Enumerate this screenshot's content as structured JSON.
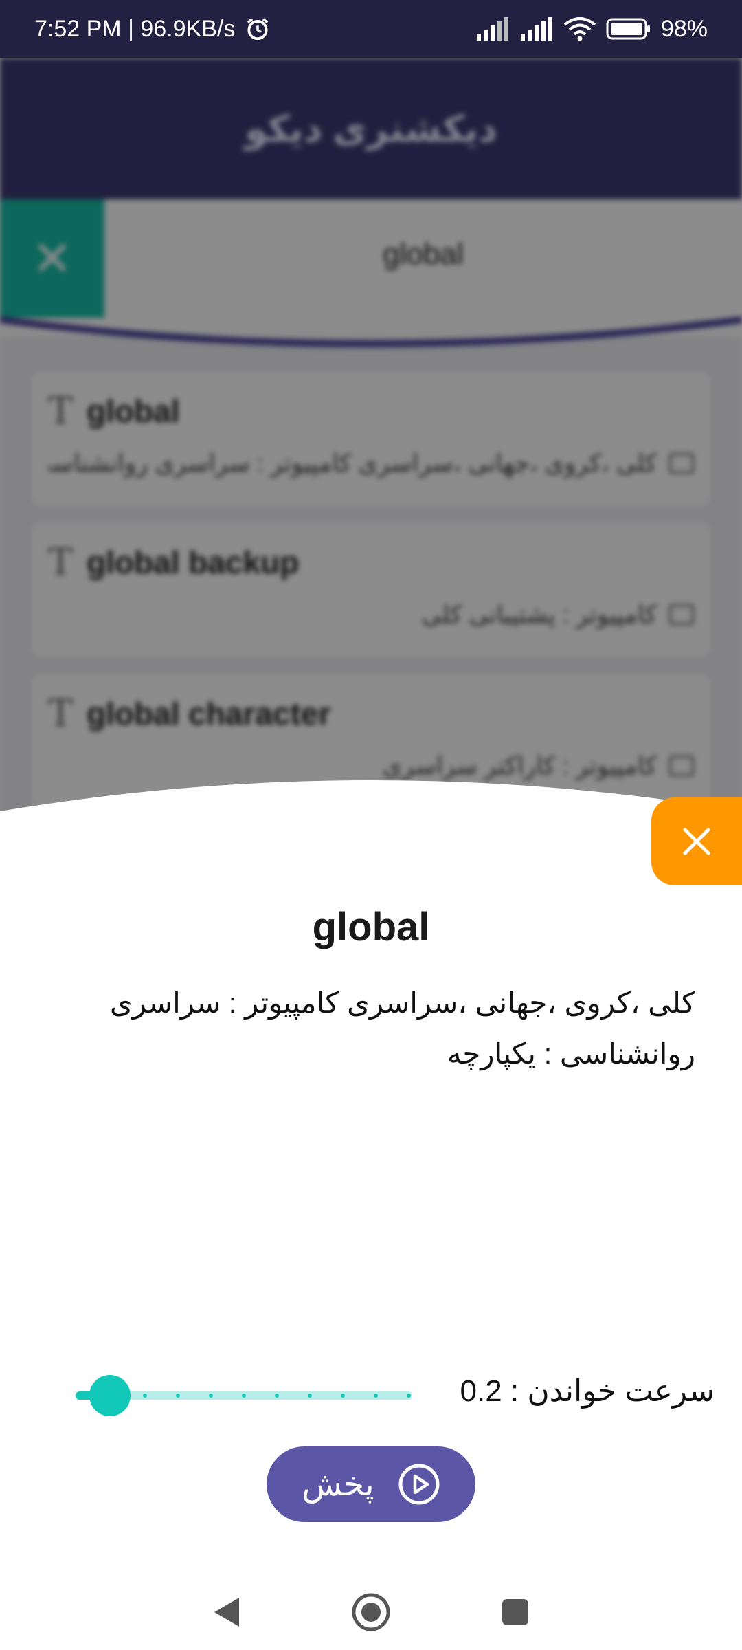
{
  "status_bar": {
    "time_speed": "7:52 PM | 96.9KB/s",
    "battery": "98%"
  },
  "app": {
    "title": "دیکشنری دیکو"
  },
  "search": {
    "query": "global"
  },
  "results": [
    {
      "word": "global",
      "meaning": "کلی ،کروی ،جهانی ،سراسری کامپیوتر : سراسری روانشناسی : یکپارچه"
    },
    {
      "word": "global backup",
      "meaning": "کامپیوتر : پشتیبانی کلی"
    },
    {
      "word": "global character",
      "meaning": "کامپیوتر : کاراکتر سراسری"
    }
  ],
  "detail": {
    "word": "global",
    "meaning": "کلی ،کروی ،جهانی ،سراسری کامپیوتر : سراسری روانشناسی : یکپارچه",
    "speed_label": "سرعت خواندن : 0.2",
    "speed_value": 0.2,
    "play_label": "پخش"
  },
  "colors": {
    "primary": "#3d3a73",
    "accent_teal": "#12c8b8",
    "close_orange": "#ff9800",
    "play_button": "#5b56a6"
  },
  "icons": {
    "alarm": "alarm-icon",
    "signal": "signal-icon",
    "wifi": "wifi-icon",
    "battery": "battery-icon",
    "close": "close-icon",
    "play": "play-circle-icon",
    "back": "back-icon",
    "home": "home-icon",
    "recents": "recents-icon"
  }
}
